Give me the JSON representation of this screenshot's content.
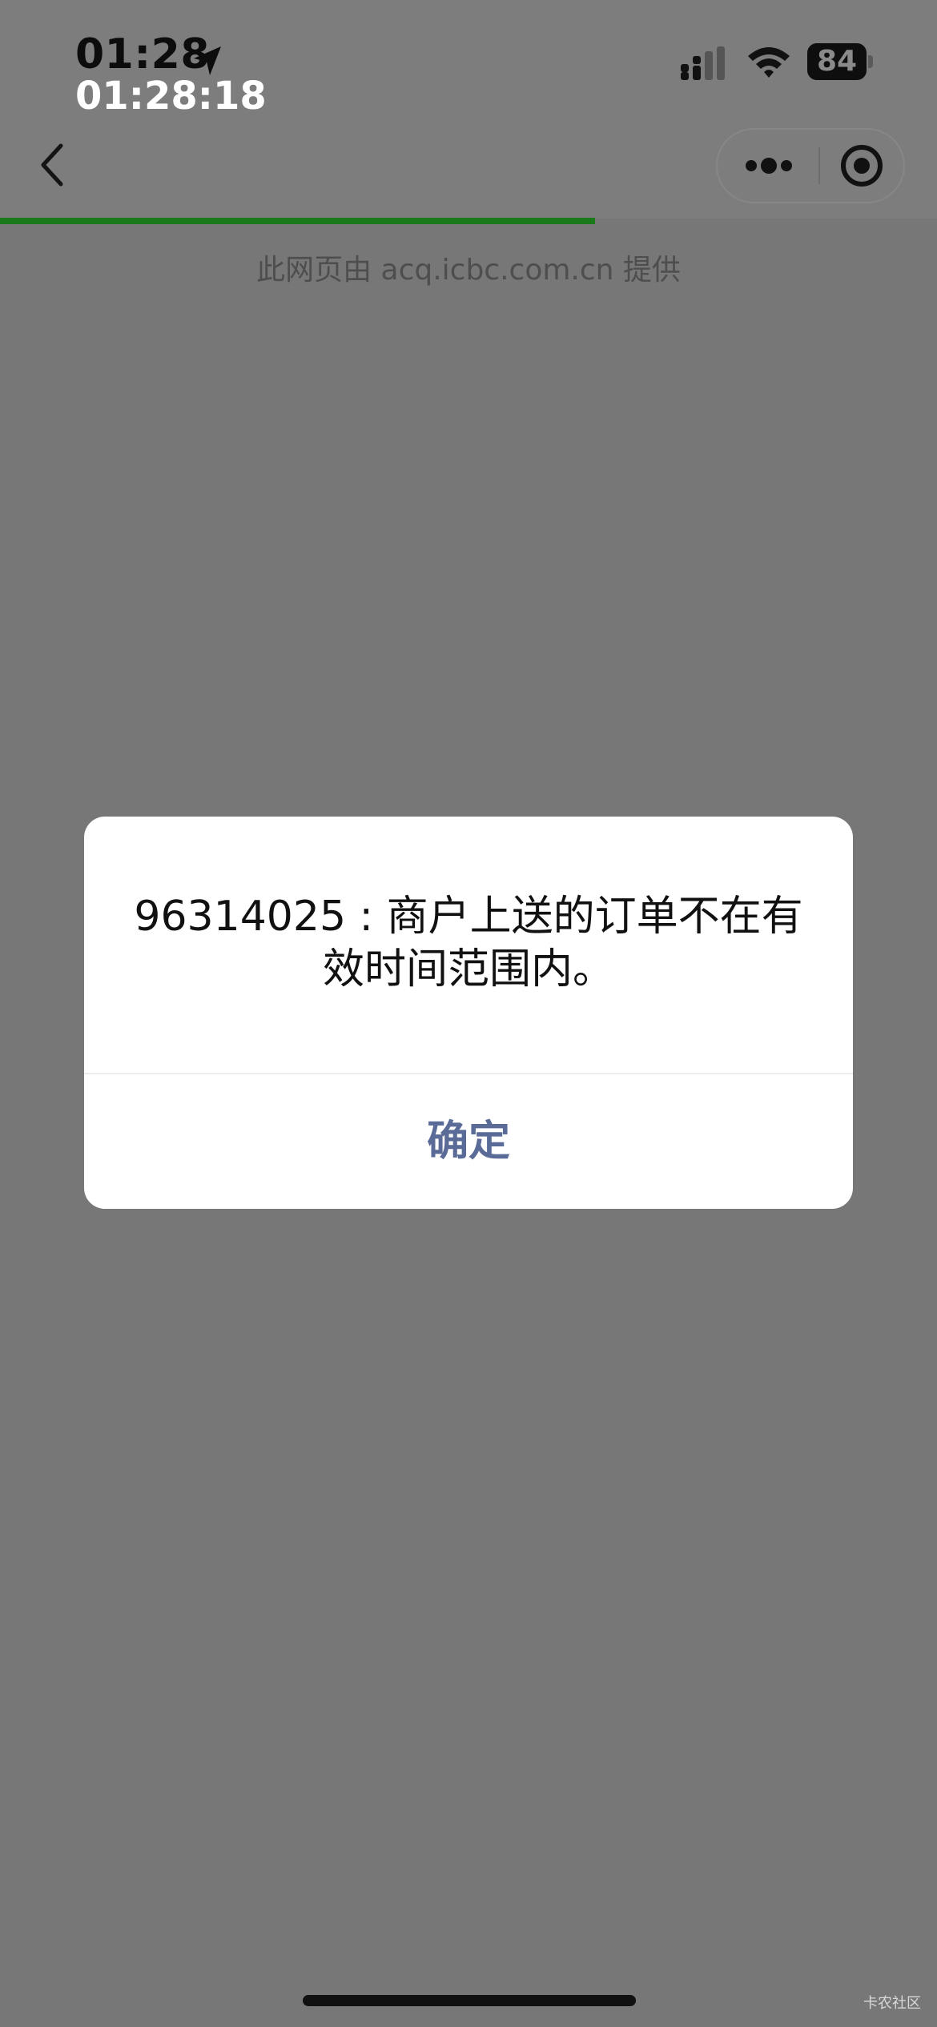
{
  "status_bar": {
    "time": "01:28",
    "seconds_clock": "01:28:18",
    "battery_level": "84",
    "icons": [
      "location-arrow-icon",
      "cellular-signal-icon",
      "wifi-icon",
      "battery-icon"
    ]
  },
  "nav": {
    "icons": [
      "back-chevron-icon",
      "more-dots-icon",
      "close-target-icon"
    ],
    "load_progress": 0.635
  },
  "provider_notice": "此网页由 acq.icbc.com.cn 提供",
  "dialog": {
    "message": "96314025 : 商户上送的订单不在有效时间范围内。",
    "confirm_label": "确定"
  },
  "watermark": "卡农社区",
  "colors": {
    "overlay_background": "#777777",
    "progress": "#1a7a1a",
    "confirm_text": "#596b96"
  }
}
